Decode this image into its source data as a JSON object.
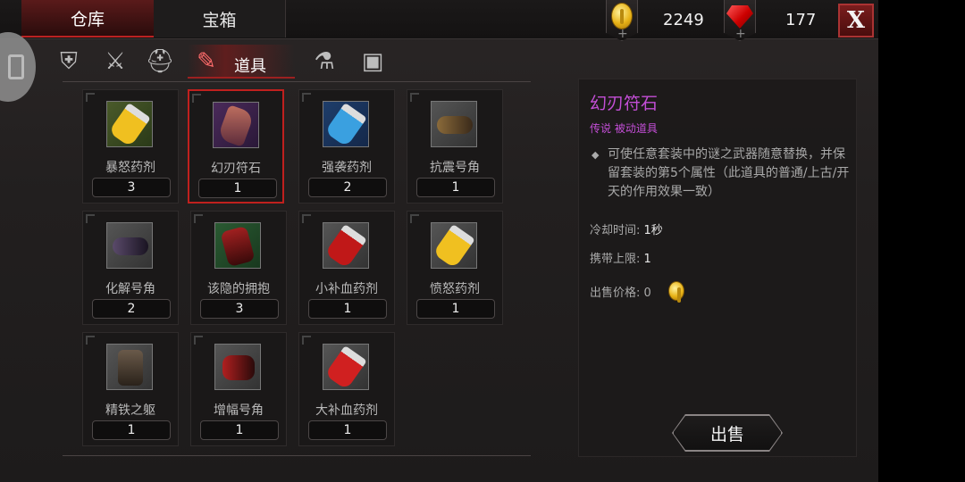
{
  "main_tabs": [
    {
      "label": "仓库",
      "active": true
    },
    {
      "label": "宝箱",
      "active": false
    }
  ],
  "currency": {
    "gold": {
      "icon": "gold-coin-icon",
      "amount": "2249"
    },
    "gems": {
      "icon": "red-gem-icon",
      "amount": "177"
    }
  },
  "close_label": "X",
  "category_tabs": [
    {
      "icon": "armor-icon",
      "glyph": "⛨"
    },
    {
      "icon": "sword-icon",
      "glyph": "⚔"
    },
    {
      "icon": "helmet-icon",
      "glyph": "⛑"
    },
    {
      "icon": "potion-icon",
      "label": "道具",
      "active": true
    },
    {
      "icon": "scroll-icon",
      "glyph": "⚗"
    },
    {
      "icon": "book-icon",
      "glyph": "▣"
    }
  ],
  "items": [
    {
      "name": "暴怒药剂",
      "count": "3",
      "color": "gold",
      "art": "yellow-potion"
    },
    {
      "name": "幻刃符石",
      "count": "1",
      "color": "purple",
      "art": "rune-stone",
      "selected": true
    },
    {
      "name": "强袭药剂",
      "count": "2",
      "color": "blue",
      "art": "blue-potion"
    },
    {
      "name": "抗震号角",
      "count": "1",
      "color": "gray",
      "art": "horn"
    },
    {
      "name": "化解号角",
      "count": "2",
      "color": "gray",
      "art": "dark-horn"
    },
    {
      "name": "该隐的拥抱",
      "count": "3",
      "color": "green",
      "art": "red-charm"
    },
    {
      "name": "小补血药剂",
      "count": "1",
      "color": "gray",
      "art": "red-potion"
    },
    {
      "name": "愤怒药剂",
      "count": "1",
      "color": "gray",
      "art": "yellow-potion"
    },
    {
      "name": "精铁之躯",
      "count": "1",
      "color": "gray",
      "art": "iron-armor"
    },
    {
      "name": "增幅号角",
      "count": "1",
      "color": "gray",
      "art": "red-horn"
    },
    {
      "name": "大补血药剂",
      "count": "1",
      "color": "gray",
      "art": "red-potion"
    }
  ],
  "detail": {
    "title": "幻刃符石",
    "subtitle": "传说 被动道具",
    "bullet": "◆",
    "description": "可使任意套装中的谜之武器随意替换，并保留套装的第5个属性（此道具的普通/上古/开天的作用效果一致）",
    "cooldown_label": "冷却时间:",
    "cooldown_value": "1秒",
    "carry_label": "携带上限:",
    "carry_value": "1",
    "price_label": "出售价格:",
    "price_value": "0",
    "sell_label": "出售"
  },
  "colors": {
    "accent_red": "#c0201e",
    "legend_purple": "#c34ed6"
  }
}
